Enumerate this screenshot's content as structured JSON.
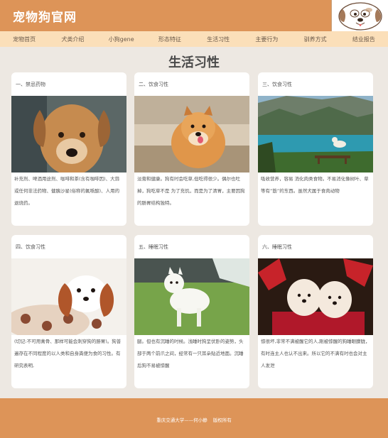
{
  "header": {
    "site_title": "宠物狗官网"
  },
  "nav": {
    "items": [
      "宠物首页",
      "犬类介绍",
      "小狗gene",
      "形态特征",
      "生活习性",
      "主要行为",
      "驯养方式",
      "结业报告"
    ]
  },
  "main": {
    "page_title": "生活习性",
    "cards": [
      {
        "heading": "一、禁忌药物",
        "text": "补充剂、啤酒用途剂、咖啡和茶(含有咖啡因)、大蒜或任何非法药物、健胰沙星(俗称的氟哌酸)、人用的退烧药。",
        "image": "brown-puppy-photo"
      },
      {
        "heading": "二、饮食习性",
        "text": "淡膏和健康。狗有时会吃草,但吃得很少。偶尔也吐掉，狗吃草不是 为了充饥，而是为了清胃，主要因狗的肠胃结构独特。",
        "image": "pomeranian-photo"
      },
      {
        "heading": "三、饮食习性",
        "text": "吸收营养，容易 消化肉类食物。不易消化像树叶、草等有“筋”的东西。虽然犬属于食肉动物",
        "image": "lake-dog-photo"
      },
      {
        "heading": "四、饮食习性",
        "text": "(切记:不可用禽骨、那样可能会刺穿狗的肠胃)。狗普遍存在不同程度的以人类和自身粪便为食的习性。有研究表明,",
        "image": "cavalier-puppy-photo"
      },
      {
        "heading": "五、睡眠习性",
        "text": "腿。但也有沉睡的时候。浅睡时狗呈伏卧的姿势，头部于两个前爪之间，经常有一只耳朵贴近地面。沉睡后狗不易被惊醒",
        "image": "samoyed-photo"
      },
      {
        "heading": "六、睡眠习性",
        "text": "惊很坏,非常不满被醒它的人,刚被惊醒的狗睡眼朦胧，有时连主人也认不出来。所以它的不满有时也会对主人发泄",
        "image": "white-puppies-photo"
      }
    ]
  },
  "footer": {
    "school": "重庆交通大学——何小静",
    "rights": "版权所有"
  },
  "colors": {
    "header_bg": "#dd9458",
    "nav_bg": "#fbdfb9",
    "page_bg": "#ede8e2",
    "card_bg": "#ffffff"
  }
}
